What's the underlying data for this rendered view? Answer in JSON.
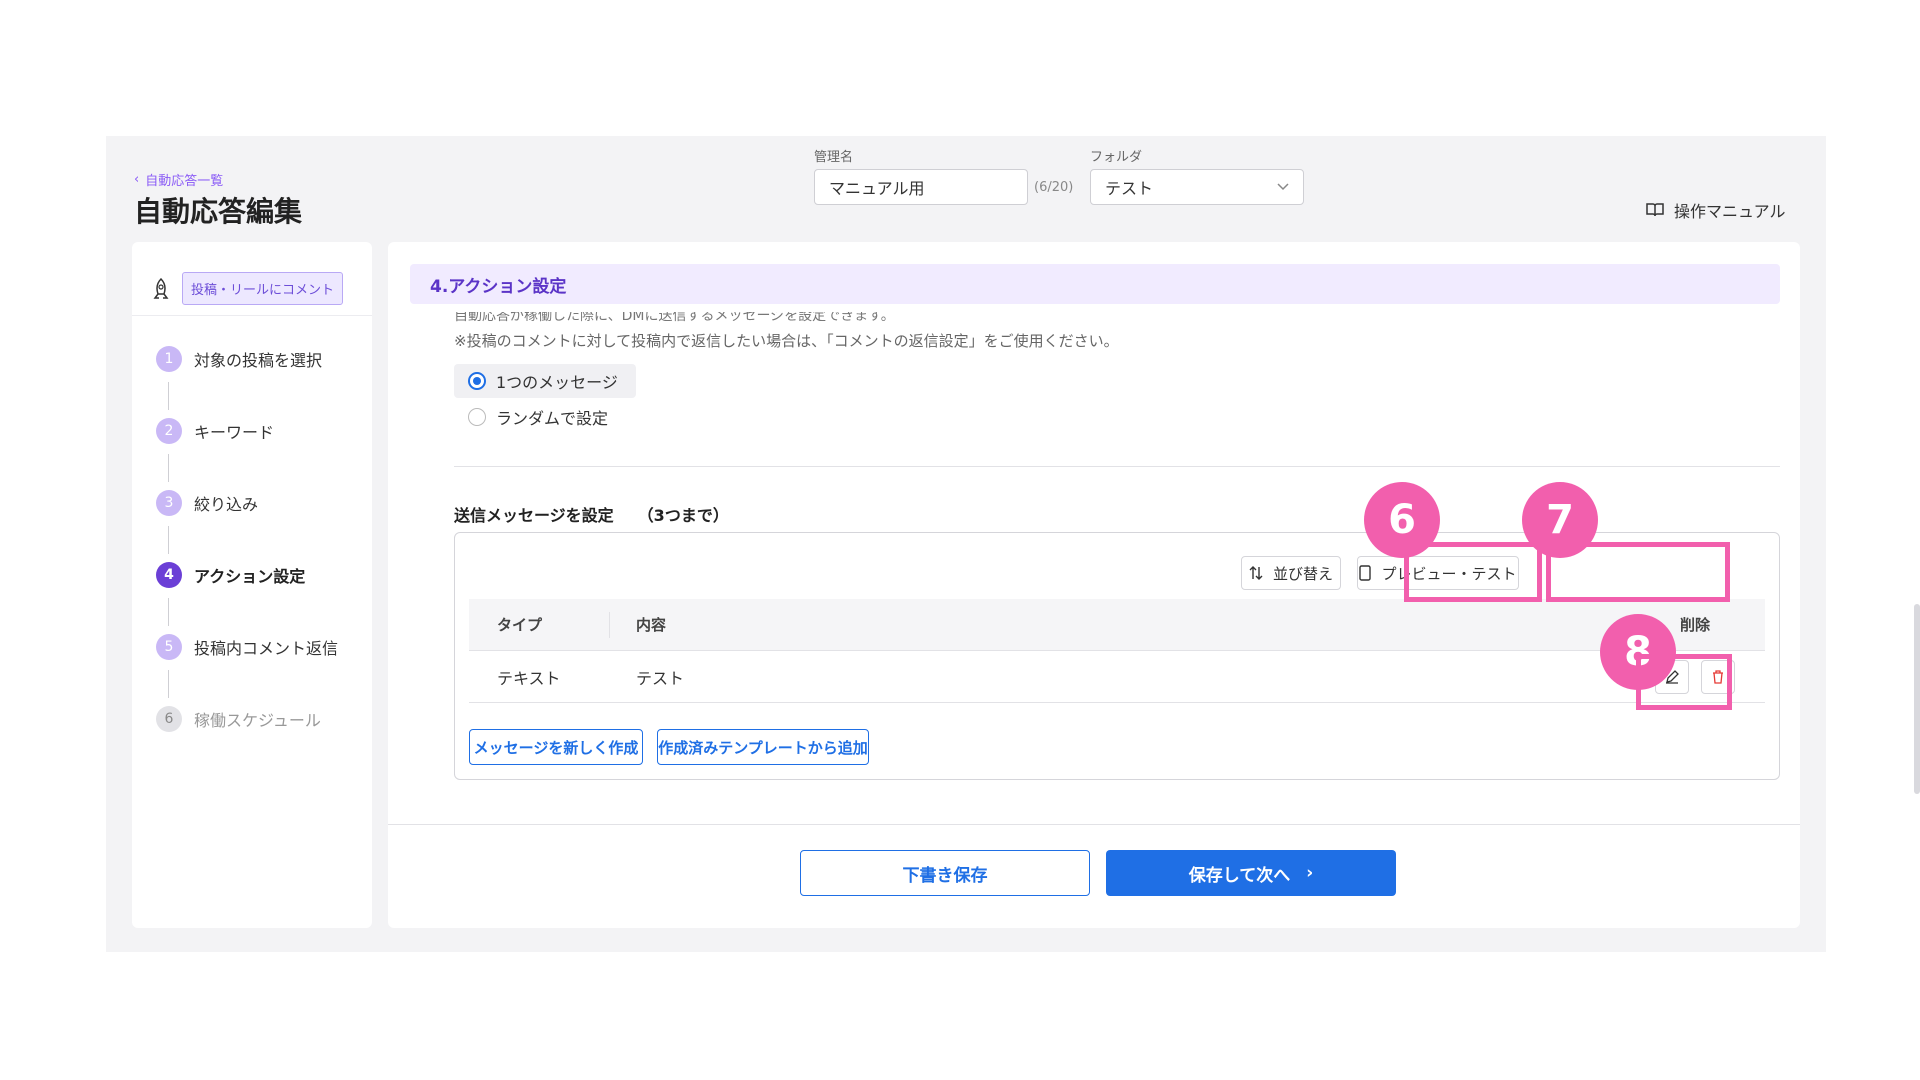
{
  "header": {
    "back_label": "自動応答一覧",
    "title": "自動応答編集",
    "name_label": "管理名",
    "name_value": "マニュアル用",
    "name_counter": "(6/20)",
    "folder_label": "フォルダ",
    "folder_value": "テスト",
    "manual_label": "操作マニュアル"
  },
  "sidebar": {
    "trigger_tag": "投稿・リールにコメント",
    "steps": [
      {
        "num": "1",
        "label": "対象の投稿を選択"
      },
      {
        "num": "2",
        "label": "キーワード"
      },
      {
        "num": "3",
        "label": "絞り込み"
      },
      {
        "num": "4",
        "label": "アクション設定"
      },
      {
        "num": "5",
        "label": "投稿内コメント返信"
      },
      {
        "num": "6",
        "label": "稼働スケジュール"
      }
    ]
  },
  "main": {
    "section_title": "4.アクション設定",
    "desc_line1": "自動応答が稼働した際に、DMに送信するメッセージを設定できます。",
    "desc_line2": "※投稿のコメントに対して投稿内で返信したい場合は、「コメントの返信設定」をご使用ください。",
    "radio_options": [
      "1つのメッセージ",
      "ランダムで設定"
    ],
    "message_label": "送信メッセージを設定　　（3つまで）",
    "sort_button": "並び替え",
    "preview_button": "プレビュー・テスト",
    "table": {
      "headers": {
        "type": "タイプ",
        "content": "内容",
        "delete": "削除"
      },
      "rows": [
        {
          "type": "テキスト",
          "content": "テスト"
        }
      ]
    },
    "new_message_button": "メッセージを新しく作成",
    "template_button": "作成済みテンプレートから追加"
  },
  "footer": {
    "draft_button": "下書き保存",
    "next_button": "保存して次へ"
  },
  "annotations": [
    "6",
    "7",
    "8"
  ],
  "colors": {
    "accent_purple": "#6b3fd6",
    "primary_blue": "#1f6fe5",
    "highlight_pink": "#f25fad"
  }
}
